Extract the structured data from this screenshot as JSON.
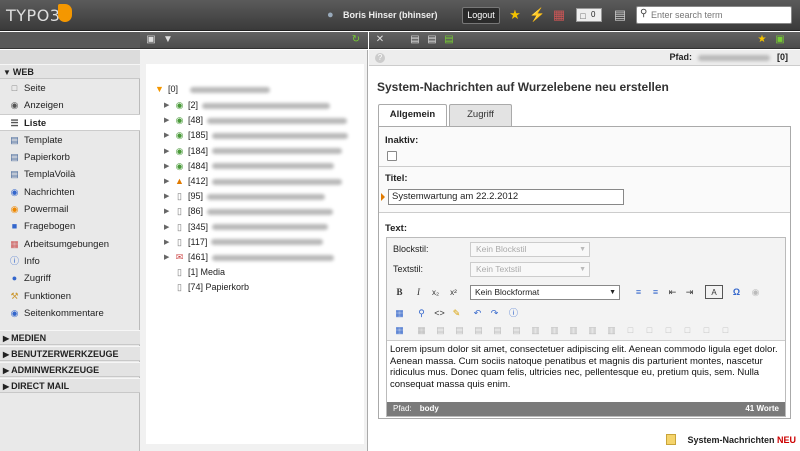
{
  "topbar": {
    "logo": "TYPO3",
    "user": "Boris Hinser (bhinser)",
    "logout_label": "Logout",
    "open_docs_count": "0",
    "search_placeholder": "Enter search term"
  },
  "module_menu": {
    "sections": [
      {
        "title": "WEB",
        "items": [
          {
            "label": "Seite",
            "icon": "page-icon"
          },
          {
            "label": "Anzeigen",
            "icon": "eye-icon"
          },
          {
            "label": "Liste",
            "icon": "list-icon",
            "active": true
          },
          {
            "label": "Template",
            "icon": "template-icon"
          },
          {
            "label": "Papierkorb",
            "icon": "trash-icon"
          },
          {
            "label": "TemplaVoilà",
            "icon": "templavoila-icon"
          },
          {
            "label": "Nachrichten",
            "icon": "news-icon"
          },
          {
            "label": "Powermail",
            "icon": "powermail-icon"
          },
          {
            "label": "Fragebogen",
            "icon": "questionnaire-icon"
          },
          {
            "label": "Arbeitsumgebungen",
            "icon": "workspace-icon"
          },
          {
            "label": "Info",
            "icon": "info-icon"
          },
          {
            "label": "Zugriff",
            "icon": "access-icon"
          },
          {
            "label": "Funktionen",
            "icon": "functions-icon"
          },
          {
            "label": "Seitenkommentare",
            "icon": "comments-icon"
          }
        ]
      },
      {
        "title": "MEDIEN"
      },
      {
        "title": "BENUTZERWERKZEUGE"
      },
      {
        "title": "ADMINWERKZEUGE"
      },
      {
        "title": "DIRECT MAIL"
      }
    ]
  },
  "page_tree": {
    "root": "[0]",
    "nodes": [
      {
        "id": "[2]",
        "type": "site"
      },
      {
        "id": "[48]",
        "type": "site"
      },
      {
        "id": "[185]",
        "type": "site"
      },
      {
        "id": "[184]",
        "type": "site"
      },
      {
        "id": "[484]",
        "type": "site"
      },
      {
        "id": "[412]",
        "type": "user"
      },
      {
        "id": "[95]",
        "type": "page"
      },
      {
        "id": "[86]",
        "type": "page"
      },
      {
        "id": "[345]",
        "type": "page"
      },
      {
        "id": "[117]",
        "type": "page"
      },
      {
        "id": "[461]",
        "type": "mail"
      },
      {
        "id": "[1] Media",
        "type": "page"
      },
      {
        "id": "[74] Papierkorb",
        "type": "page"
      }
    ]
  },
  "content": {
    "path_label": "Pfad:",
    "path_value": "[0]",
    "heading": "System-Nachrichten auf Wurzelebene neu erstellen",
    "tabs": [
      "Allgemein",
      "Zugriff"
    ],
    "inaktiv_label": "Inaktiv:",
    "titel_label": "Titel:",
    "titel_value": "Systemwartung am 22.2.2012",
    "text_label": "Text:",
    "rte": {
      "blockstil_label": "Blockstil:",
      "blockstil_value": "Kein Blockstil",
      "textstil_label": "Textstil:",
      "textstil_value": "Kein Textstil",
      "blockformat_value": "Kein Blockformat",
      "body": "Lorem ipsum dolor sit amet, consectetuer adipiscing elit. Aenean commodo ligula eget dolor. Aenean massa. Cum sociis natoque penatibus et magnis dis parturient montes, nascetur ridiculus mus. Donec quam felis, ultricies nec, pellentesque eu, pretium quis, sem. Nulla consequat massa quis enim.",
      "path_label": "Pfad:",
      "path_value": "body",
      "word_count": "41 Worte"
    },
    "footer_record": "System-Nachrichten",
    "footer_new": "NEU"
  }
}
